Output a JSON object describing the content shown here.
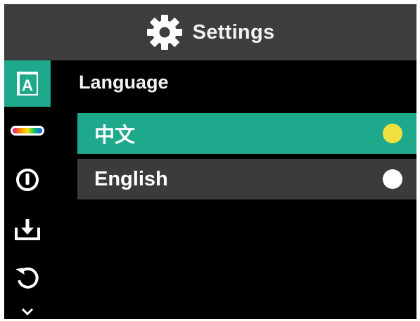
{
  "header": {
    "title": "Settings",
    "icon": "gear-icon"
  },
  "sidebar": {
    "items": [
      {
        "name": "language",
        "icon": "language-a-icon",
        "active": true
      },
      {
        "name": "palette",
        "icon": "color-palette-bar-icon",
        "active": false
      },
      {
        "name": "power",
        "icon": "power-icon",
        "active": false
      },
      {
        "name": "download",
        "icon": "download-tray-icon",
        "active": false
      },
      {
        "name": "reset",
        "icon": "reset-arrow-icon",
        "active": false
      },
      {
        "name": "more",
        "icon": "chevron-down-icon",
        "active": false
      }
    ]
  },
  "main": {
    "section_label": "Language",
    "options": [
      {
        "label": "中文",
        "selected": true,
        "indicator_color": "#f0e040"
      },
      {
        "label": "English",
        "selected": false,
        "indicator_color": "#ffffff"
      }
    ]
  },
  "colors": {
    "accent": "#1ea88c",
    "header_bg": "#3d3d3d",
    "row_bg": "#3b3b3b",
    "background": "#000000"
  }
}
